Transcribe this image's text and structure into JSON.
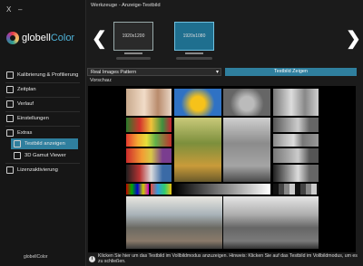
{
  "window": {
    "close": "X",
    "minimize": "–"
  },
  "brand": {
    "name_prefix": "globell",
    "name_suffix": "Color",
    "small_logo": "globellColor"
  },
  "sidebar": {
    "items": [
      {
        "label": "Kalibrierung & Profilierung"
      },
      {
        "label": "Zeitplan"
      },
      {
        "label": "Verlauf"
      },
      {
        "label": "Einstellungen"
      },
      {
        "label": "Extras"
      },
      {
        "label": "Testbild anzeigen"
      },
      {
        "label": "3D Gamut Viewer"
      },
      {
        "label": "Lizenzaktivierung"
      }
    ]
  },
  "header": {
    "title": "Werkzeuge - Anzeige-Testbild"
  },
  "monitors": [
    {
      "resolution": "1920x1200",
      "selected": false
    },
    {
      "resolution": "1920x1080",
      "selected": true
    }
  ],
  "pattern": {
    "selected": "Real Images Pattern",
    "show_button": "Testbild Zeigen"
  },
  "preview": {
    "label": "Vorschau:"
  },
  "info": {
    "text": "Klicken Sie hier um das Testbild im Vollbildmodus anzuzeigen. Hinweis: Klicken Sie auf das Testbild im Vollbildmodus, um es zu schließen."
  },
  "colors": {
    "accent": "#2f7f9e",
    "background": "#1b1b1b"
  }
}
